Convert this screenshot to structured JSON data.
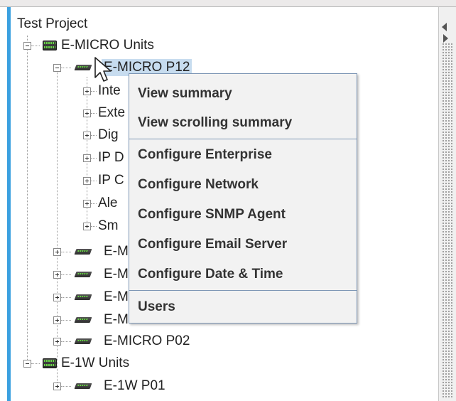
{
  "tree": {
    "root": "Test Project",
    "group1": {
      "label": "E-MICRO Units",
      "selected_device": "E-MICRO P12",
      "children_partial": [
        "Inte",
        "Exte",
        "Dig",
        "IP D",
        "IP C",
        "Ale",
        "Sm"
      ],
      "collapsed_devices_partial": [
        "E-M",
        "E-M",
        "E-M",
        "E-M"
      ],
      "last_device": "E-MICRO P02"
    },
    "group2": {
      "label": "E-1W Units",
      "device": "E-1W P01"
    }
  },
  "context_menu": {
    "items": [
      "View summary",
      "View scrolling summary",
      "Configure Enterprise",
      "Configure Network",
      "Configure SNMP Agent",
      "Configure Email Server",
      "Configure Date & Time",
      "Users"
    ]
  },
  "icons": {
    "group": "network-group-icon",
    "device": "device-unit-icon",
    "toggle_expanded": "minus-box-icon",
    "toggle_collapsed": "plus-box-icon",
    "cursor": "mouse-pointer-icon"
  },
  "colors": {
    "selection": "#c7dcef",
    "menu_border": "#7d96b5",
    "accent_bar": "#3aa0e0"
  }
}
